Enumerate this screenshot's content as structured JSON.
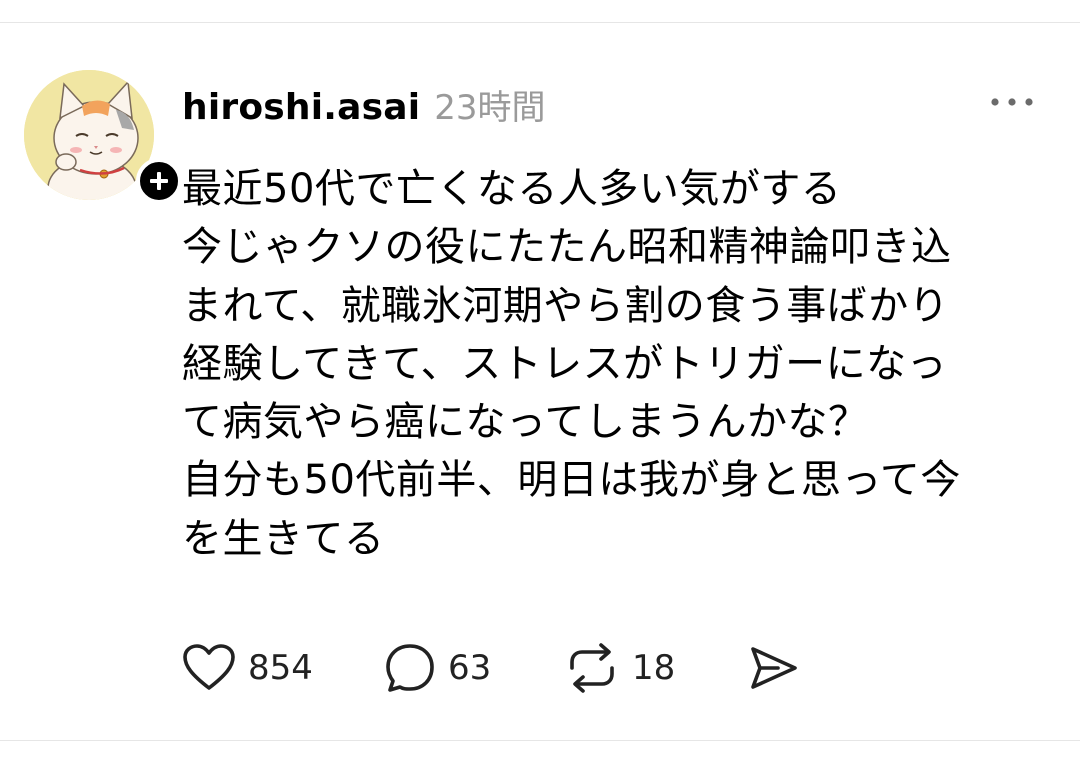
{
  "post": {
    "author": {
      "username": "hiroshi.asai"
    },
    "timestamp": "23時間",
    "body_lines": [
      "最近50代で亡くなる人多い気がする",
      "今じゃクソの役にたたん昭和精神論叩き込",
      "まれて、就職氷河期やら割の食う事ばかり",
      "経験してきて、ストレスがトリガーになっ",
      "て病気やら癌になってしまうんかな？",
      "自分も50代前半、明日は我が身と思って今",
      "を生きてる"
    ],
    "actions": {
      "likes": "854",
      "comments": "63",
      "reposts": "18"
    }
  },
  "icons": {
    "follow": "plus-icon",
    "more": "more-horizontal-icon",
    "like": "heart-icon",
    "comment": "comment-bubble-icon",
    "repost": "repost-arrows-icon",
    "share": "send-icon"
  },
  "colors": {
    "text": "#000000",
    "timestamp": "#9a9a9a",
    "divider": "#e6e6e6",
    "avatar_background": "#f1e6a3"
  }
}
